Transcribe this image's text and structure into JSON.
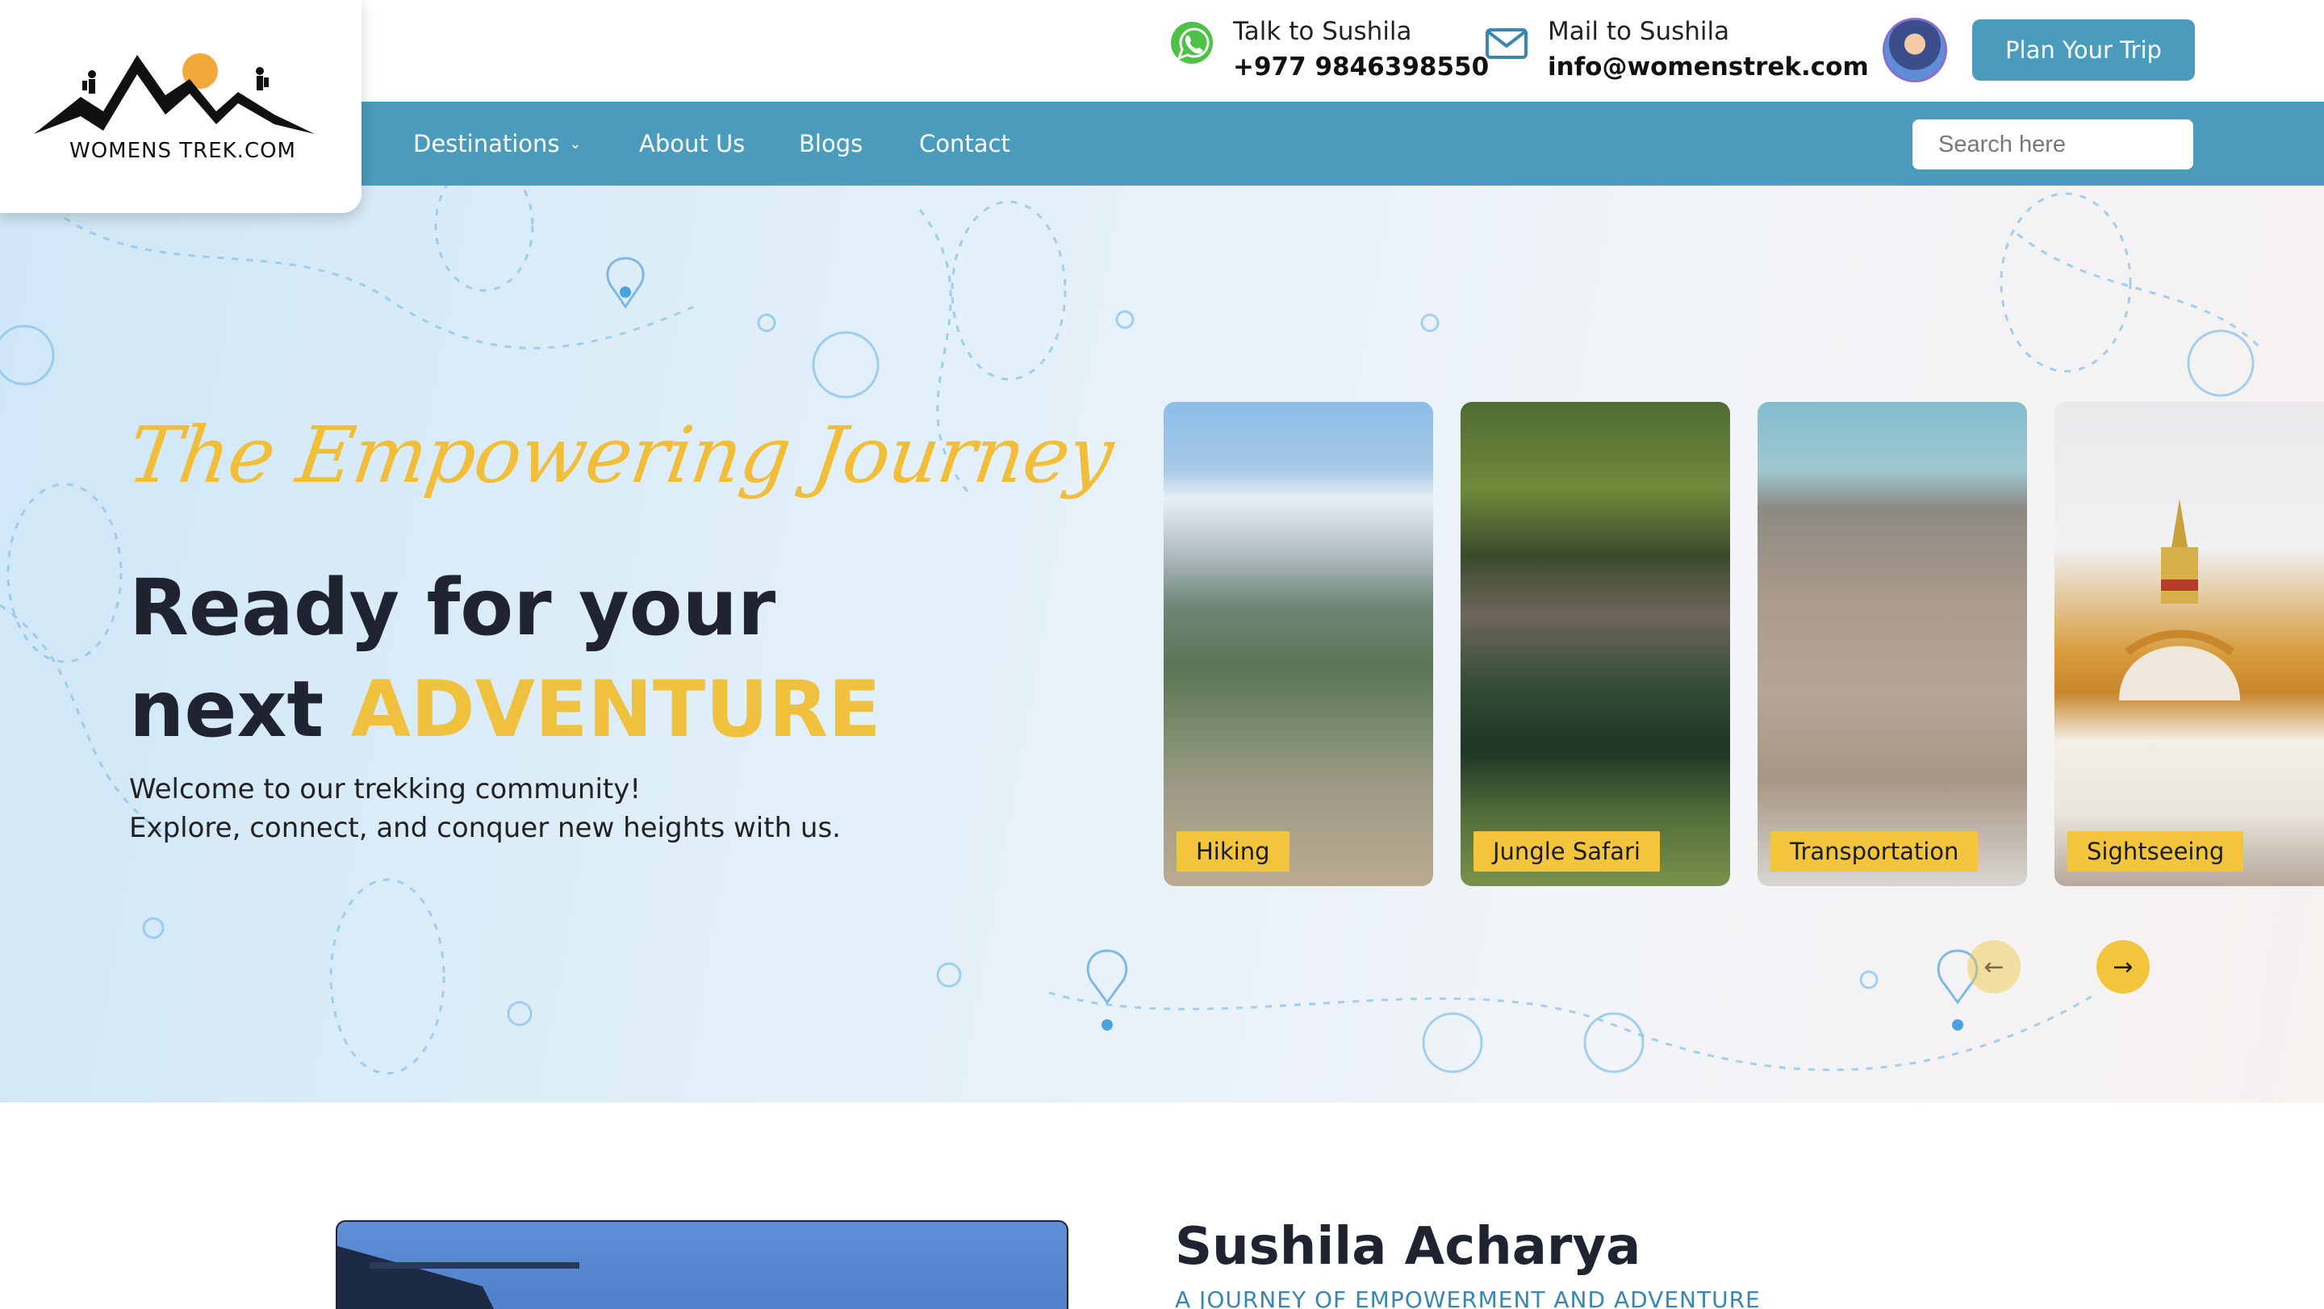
{
  "brand": {
    "name": "WOMENS TREK.COM"
  },
  "contacts": [
    {
      "icon": "whatsapp-icon",
      "label": "Talk to Sushila",
      "value": "+977 9846398550"
    },
    {
      "icon": "mail-icon",
      "label": "Mail to Sushila",
      "value": "info@womenstrek.com"
    }
  ],
  "header": {
    "cta_label": "Plan Your Trip"
  },
  "nav": {
    "items": [
      "Destinations",
      "About Us",
      "Blogs",
      "Contact"
    ],
    "search_placeholder": "Search here"
  },
  "hero": {
    "tagline": "The Empowering Journey",
    "headline_line1": "Ready for your",
    "headline_line2_prefix": "next ",
    "headline_line2_accent": "ADVENTURE",
    "welcome_line1": "Welcome to our trekking community!",
    "welcome_line2": "Explore, connect, and conquer new heights with us.",
    "cards": [
      "Hiking",
      "Jungle Safari",
      "Transportation",
      "Sightseeing"
    ]
  },
  "profile": {
    "name": "Sushila Acharya",
    "subtitle": "A JOURNEY OF EMPOWERMENT AND ADVENTURE"
  },
  "colors": {
    "accent": "#4b9bbd",
    "highlight": "#f0c03f",
    "text": "#1f2430"
  }
}
